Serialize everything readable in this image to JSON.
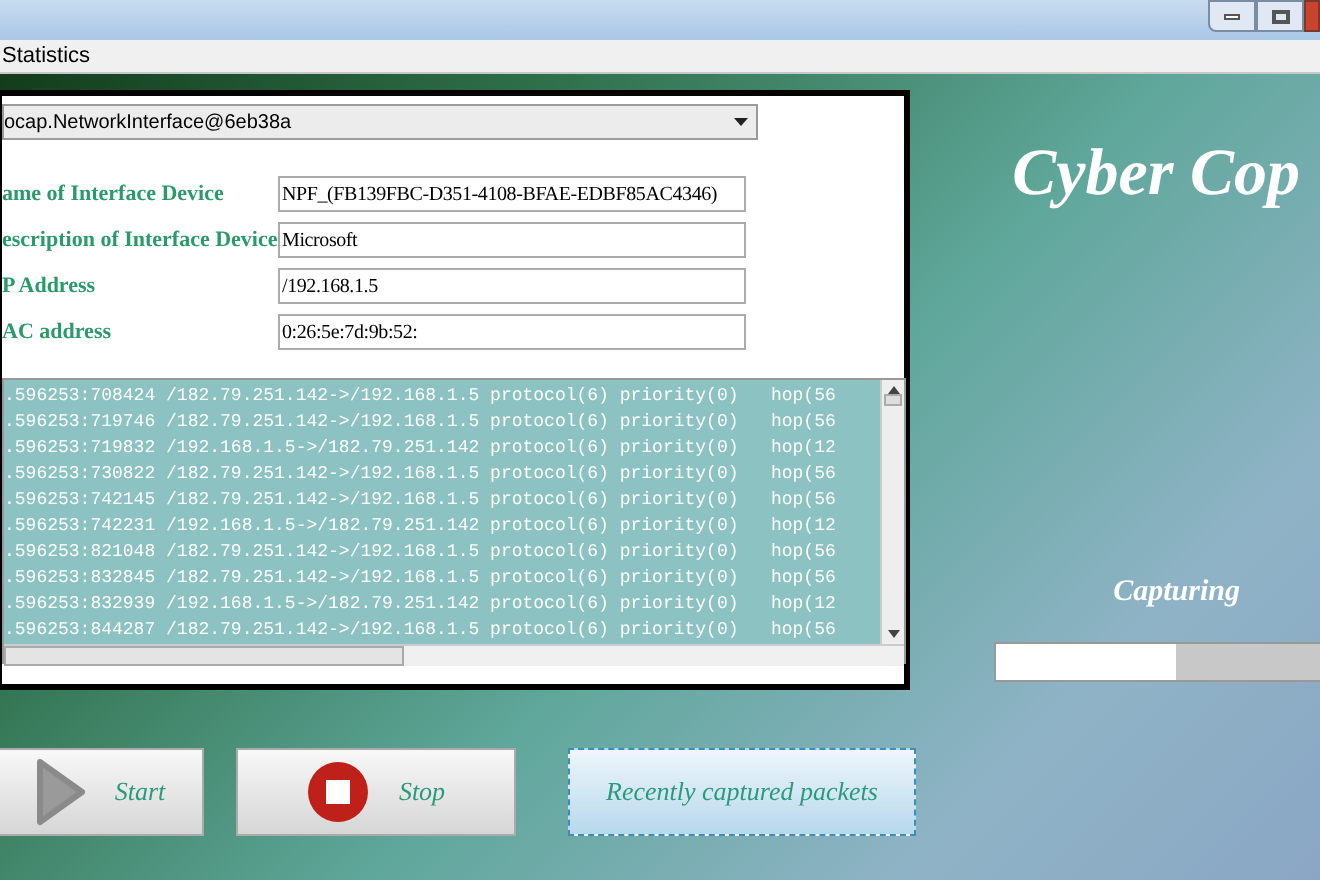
{
  "menu": [
    {
      "label": "Statistics"
    }
  ],
  "interface_select": {
    "value": "ocap.NetworkInterface@6eb38a"
  },
  "fields": [
    {
      "label": "ame of Interface Device",
      "value": "NPF_(FB139FBC-D351-4108-BFAE-EDBF85AC4346)"
    },
    {
      "label": "escription of Interface Device",
      "value": "Microsoft"
    },
    {
      "label": "P Address",
      "value": "/192.168.1.5"
    },
    {
      "label": "AC address",
      "value": "0:26:5e:7d:9b:52:"
    }
  ],
  "log": [
    {
      "text": ".596253:708424 /182.79.251.142->/192.168.1.5 protocol(6) priority(0)   hop(56"
    },
    {
      "text": ".596253:719746 /182.79.251.142->/192.168.1.5 protocol(6) priority(0)   hop(56"
    },
    {
      "text": ".596253:719832 /192.168.1.5->/182.79.251.142 protocol(6) priority(0)   hop(12"
    },
    {
      "text": ".596253:730822 /182.79.251.142->/192.168.1.5 protocol(6) priority(0)   hop(56"
    },
    {
      "text": ".596253:742145 /182.79.251.142->/192.168.1.5 protocol(6) priority(0)   hop(56"
    },
    {
      "text": ".596253:742231 /192.168.1.5->/182.79.251.142 protocol(6) priority(0)   hop(12"
    },
    {
      "text": ".596253:821048 /182.79.251.142->/192.168.1.5 protocol(6) priority(0)   hop(56"
    },
    {
      "text": ".596253:832845 /182.79.251.142->/192.168.1.5 protocol(6) priority(0)   hop(56"
    },
    {
      "text": ".596253:832939 /192.168.1.5->/182.79.251.142 protocol(6) priority(0)   hop(12"
    },
    {
      "text": ".596253:844287 /182.79.251.142->/192.168.1.5 protocol(6) priority(0)   hop(56"
    }
  ],
  "app_title": "Cyber Cop",
  "status": {
    "label": "Capturing",
    "level": 0.55
  },
  "buttons": [
    {
      "kind": "start",
      "label": "Start",
      "selected": false
    },
    {
      "kind": "stop",
      "label": "Stop",
      "selected": false
    },
    {
      "kind": "plain",
      "label": "Recently captured packets",
      "selected": true
    }
  ]
}
